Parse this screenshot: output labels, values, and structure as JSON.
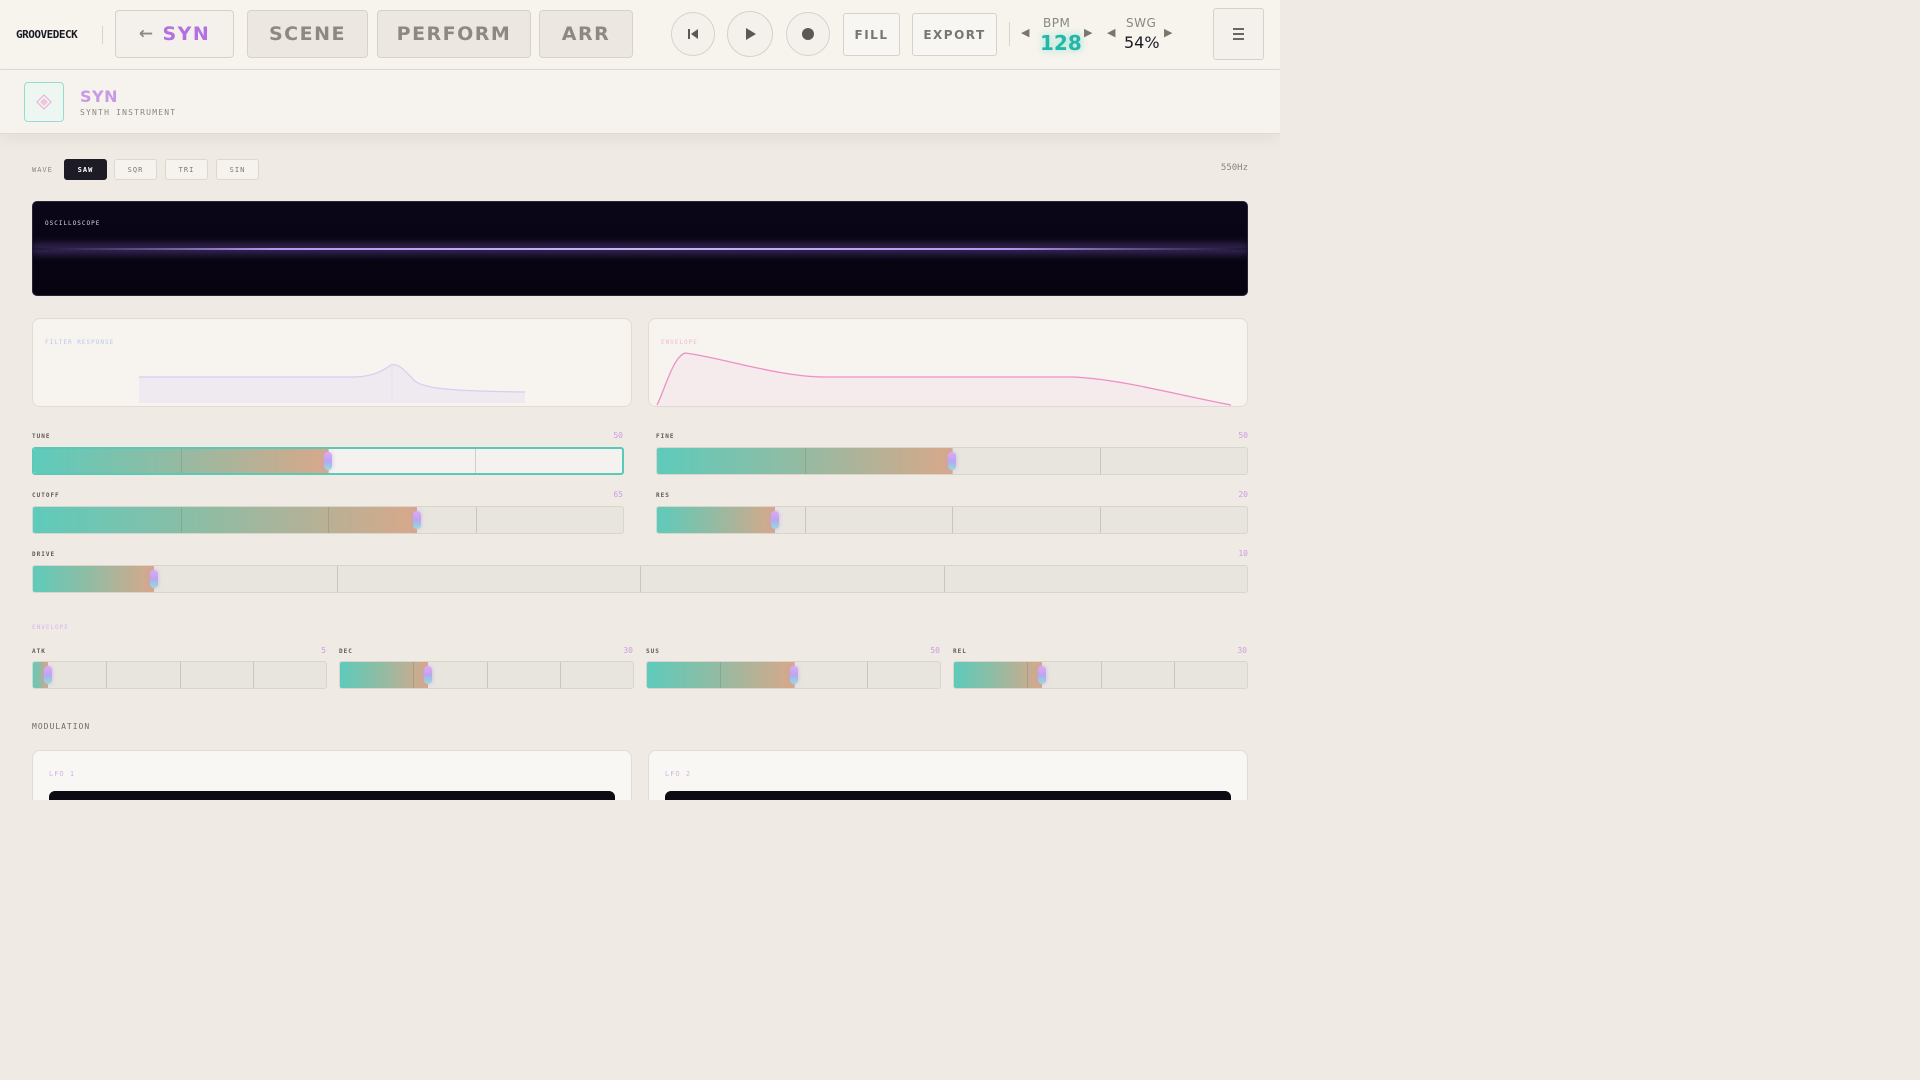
{
  "app": {
    "brand": "GROOVEDECK"
  },
  "tabs": [
    {
      "label": "SYN",
      "active": true,
      "back_arrow": "arrow-left-icon"
    },
    {
      "label": "SCENE",
      "active": false
    },
    {
      "label": "PERFORM",
      "active": false
    },
    {
      "label": "ARR",
      "active": false
    }
  ],
  "transport": {
    "buttons": [
      "skip-to-start-icon",
      "play-icon",
      "record-icon"
    ],
    "fill_label": "FILL",
    "export_label": "EXPORT"
  },
  "tempo": {
    "bpm_label": "BPM",
    "bpm_value": "128",
    "swing_label": "SWG",
    "swing_value": "54%"
  },
  "menu": {
    "icon": "hamburger-menu-icon"
  },
  "instrument": {
    "name": "SYN",
    "subtitle": "SYNTH INSTRUMENT",
    "icon": "diamond-icon"
  },
  "wave": {
    "label": "WAVE",
    "options": [
      "SAW",
      "SQR",
      "TRI",
      "SIN"
    ],
    "selected": "SAW",
    "frequency": "550Hz"
  },
  "oscilloscope": {
    "title": "OSCILLOSCOPE"
  },
  "panels": {
    "filter": {
      "title": "FILTER RESPONSE"
    },
    "envelope": {
      "title": "ENVELOPE"
    }
  },
  "params": [
    {
      "label": "TUNE",
      "value": "50",
      "level": 0.5
    },
    {
      "label": "FINE",
      "value": "50",
      "level": 0.5
    },
    {
      "label": "CUTOFF",
      "value": "65",
      "level": 0.65
    },
    {
      "label": "RES",
      "value": "20",
      "level": 0.2
    },
    {
      "label": "DRIVE",
      "value": "10",
      "level": 0.1
    }
  ],
  "envelope_section": {
    "title": "ENVELOPE",
    "params": [
      {
        "label": "ATK",
        "value": "5",
        "level": 0.05
      },
      {
        "label": "DEC",
        "value": "30",
        "level": 0.3
      },
      {
        "label": "SUS",
        "value": "50",
        "level": 0.5
      },
      {
        "label": "REL",
        "value": "30",
        "level": 0.3
      }
    ]
  },
  "modulation": {
    "title": "MODULATION",
    "lfos": [
      {
        "title": "LFO 1"
      },
      {
        "title": "LFO 2"
      }
    ]
  },
  "colors": {
    "accent_purple": "#b46fe0",
    "accent_teal": "#22b8a8",
    "slider_fill_start": "#5ecbbb",
    "slider_fill_end": "#d8a88a",
    "envelope_curve": "#ee8fc4",
    "scope_bg": "#07030f"
  }
}
